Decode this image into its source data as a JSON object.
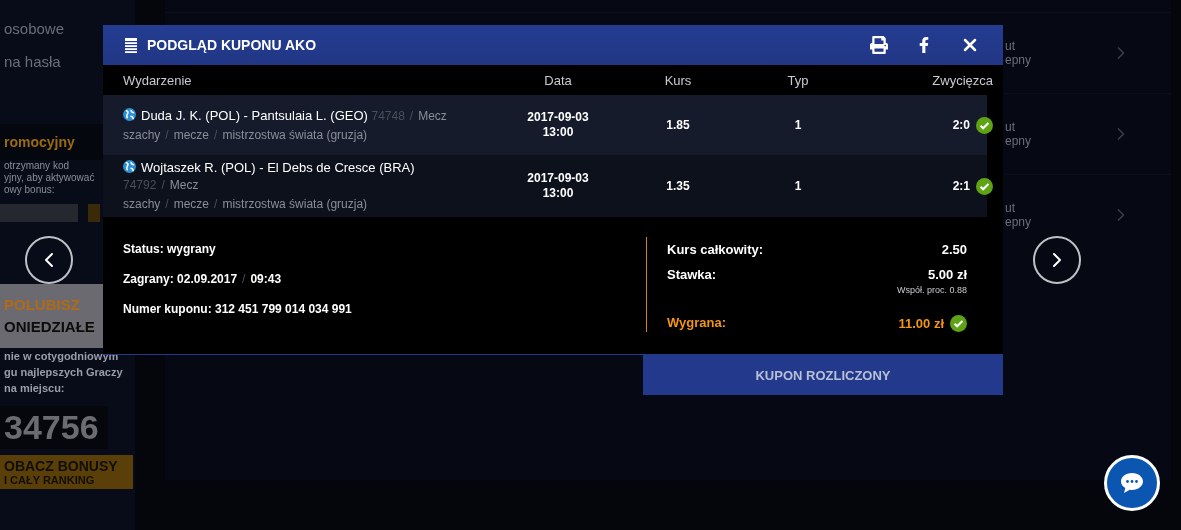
{
  "background": {
    "sidebar": {
      "menu_items": [
        "osobowe",
        "na hasła"
      ],
      "promo_title": "romocyjny",
      "promo_text": [
        "otrzymany kod",
        "yjny, aby aktywować",
        "owy bonus:"
      ],
      "banner": {
        "line1": "POLUBISZ",
        "line2": "ONIEDZIAŁE"
      },
      "ranking_text": [
        "nie w cotygodniowym",
        "gu najlepszych Graczy",
        "na miejscu:"
      ],
      "rank": "34756",
      "bonus_button": {
        "line1": "OBACZ BONUSY",
        "line2": "I CAŁY RANKING"
      }
    },
    "list_rows": [
      {
        "line1": "ut",
        "line2": "epny"
      },
      {
        "line1": "ut",
        "line2": "epny"
      },
      {
        "line1": "ut",
        "line2": "epny"
      }
    ]
  },
  "modal": {
    "title": "PODGLĄD KUPONU AKO",
    "columns": [
      "Wydarzenie",
      "Data",
      "Kurs",
      "Typ",
      "Zwycięzca"
    ],
    "rows": [
      {
        "event": "Duda J. K. (POL) - Pantsulaia L. (GEO)",
        "id": "74748",
        "type": "Mecz",
        "path": [
          "szachy",
          "mecze",
          "mistrzostwa świata (gruzja)"
        ],
        "date": "2017-09-03",
        "time": "13:00",
        "odds": "1.85",
        "pick": "1",
        "result": "2:0",
        "won": true
      },
      {
        "event": "Wojtaszek R. (POL) - El Debs de Cresce (BRA)",
        "id": "74792",
        "type": "Mecz",
        "path": [
          "szachy",
          "mecze",
          "mistrzostwa świata (gruzja)"
        ],
        "date": "2017-09-03",
        "time": "13:00",
        "odds": "1.35",
        "pick": "1",
        "result": "2:1",
        "won": true
      }
    ],
    "summary": {
      "status": "Status: wygrany",
      "placed": {
        "label": "Zagrany:",
        "date": "02.09.2017",
        "time": "09:43"
      },
      "number": "Numer kuponu: 312 451 799 014 034 991"
    },
    "totals": [
      {
        "label": "Kurs całkowity:",
        "value": "2.50"
      },
      {
        "label": "Stawka:",
        "value": "5.00 zł",
        "note": "Współ. proc. 0.88"
      }
    ],
    "win": {
      "label": "Wygrana:",
      "value": "11.00 zł",
      "won": true
    },
    "settle_button": "KUPON ROZLICZONY",
    "separator": "/"
  }
}
